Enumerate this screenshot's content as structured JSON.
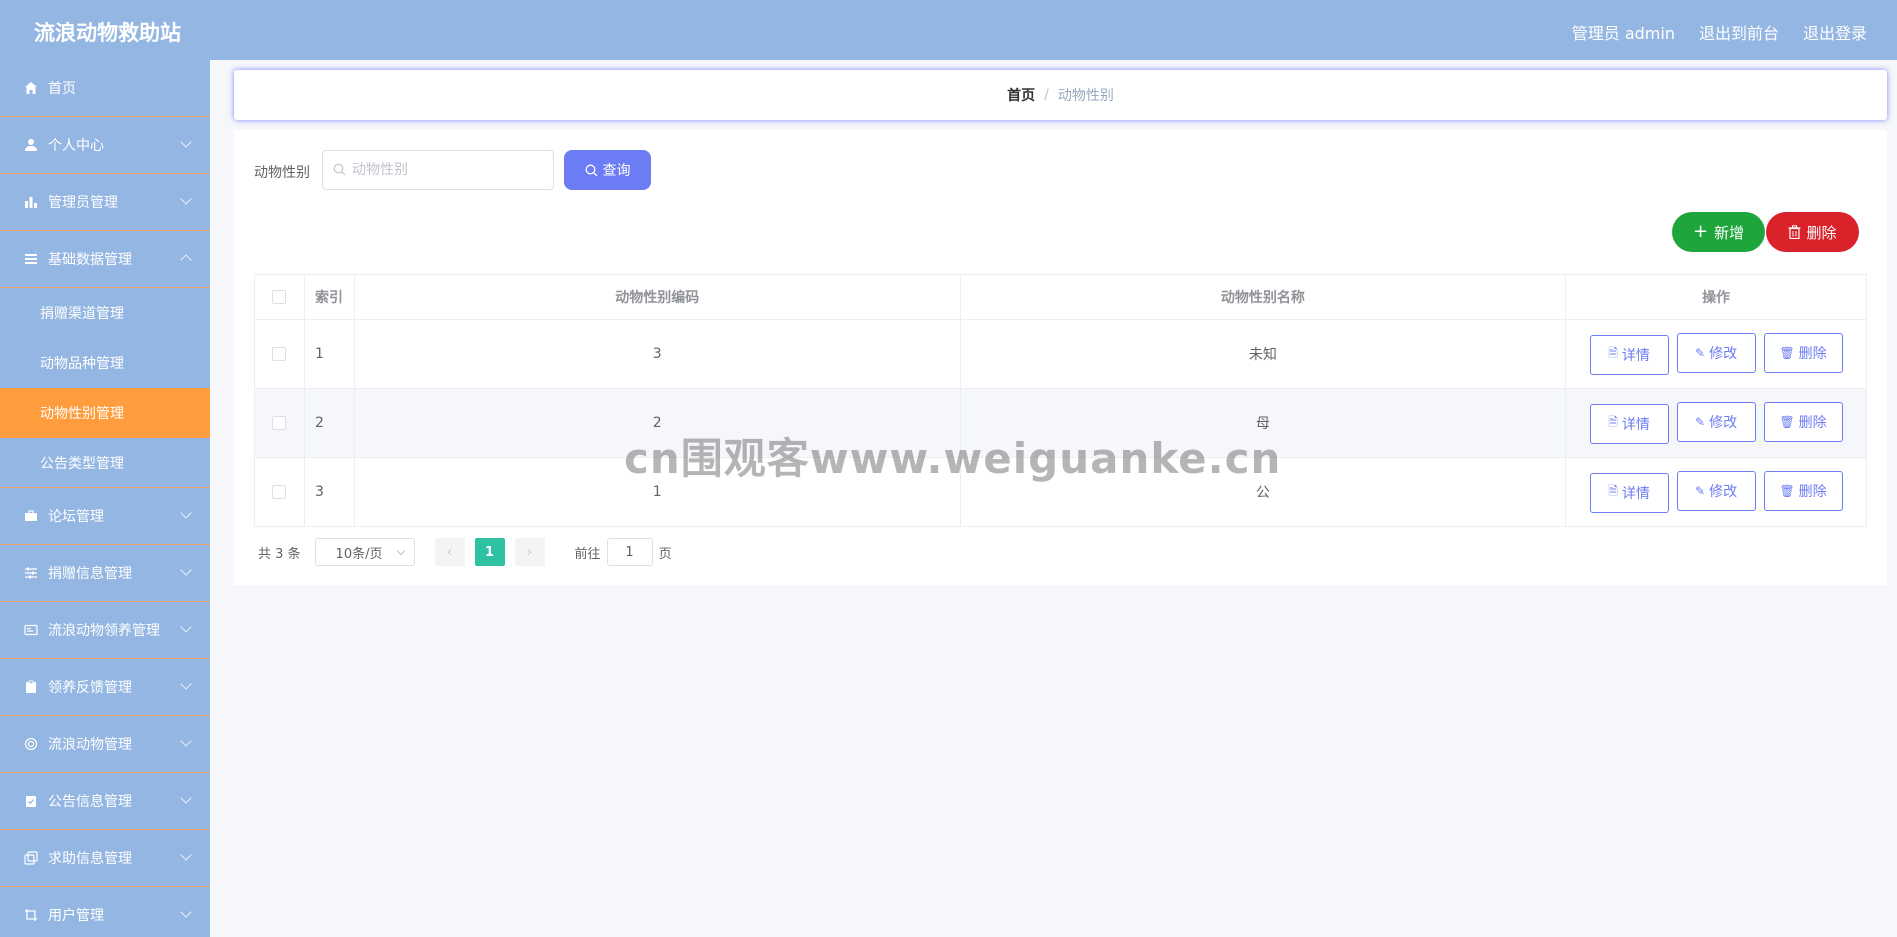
{
  "header": {
    "title": "流浪动物救助站",
    "admin_label": "管理员 admin",
    "front_label": "退出到前台",
    "logout_label": "退出登录"
  },
  "sidebar": {
    "items": [
      {
        "label": "首页",
        "icon": "home-icon"
      },
      {
        "label": "个人中心",
        "icon": "user-icon"
      },
      {
        "label": "管理员管理",
        "icon": "chart-icon"
      },
      {
        "label": "基础数据管理",
        "icon": "list-icon"
      },
      {
        "label": "论坛管理",
        "icon": "briefcase-icon"
      },
      {
        "label": "捐赠信息管理",
        "icon": "sliders-icon"
      },
      {
        "label": "流浪动物领养管理",
        "icon": "card-icon"
      },
      {
        "label": "领养反馈管理",
        "icon": "clipboard-icon"
      },
      {
        "label": "流浪动物管理",
        "icon": "circle-icon"
      },
      {
        "label": "公告信息管理",
        "icon": "clipboard-check-icon"
      },
      {
        "label": "求助信息管理",
        "icon": "copy-icon"
      },
      {
        "label": "用户管理",
        "icon": "crop-icon"
      }
    ],
    "sub_items": [
      {
        "label": "捐赠渠道管理"
      },
      {
        "label": "动物品种管理"
      },
      {
        "label": "动物性别管理"
      },
      {
        "label": "公告类型管理"
      }
    ]
  },
  "breadcrumb": {
    "home": "首页",
    "separator": "/",
    "current": "动物性别"
  },
  "search": {
    "label": "动物性别",
    "placeholder": "动物性别",
    "button": "查询"
  },
  "actions": {
    "add": "新增",
    "delete": "删除"
  },
  "table": {
    "headers": [
      "索引",
      "动物性别编码",
      "动物性别名称",
      "操作"
    ],
    "rows": [
      {
        "index": "1",
        "code": "3",
        "name": "未知"
      },
      {
        "index": "2",
        "code": "2",
        "name": "母"
      },
      {
        "index": "3",
        "code": "1",
        "name": "公"
      }
    ],
    "row_actions": {
      "detail": "详情",
      "edit": "修改",
      "delete": "删除"
    }
  },
  "pagination": {
    "total": "共 3 条",
    "page_size": "10条/页",
    "current_page": "1",
    "goto_prefix": "前往",
    "goto_value": "1",
    "goto_suffix": "页"
  },
  "watermark": "cn围观客www.weiguanke.cn",
  "colors": {
    "header_bg": "#94b6e2",
    "active_menu": "#ff9d3e",
    "primary": "#6c7cf4",
    "add": "#1ea53b",
    "danger": "#d9222a",
    "page_active": "#2ec2a3"
  }
}
